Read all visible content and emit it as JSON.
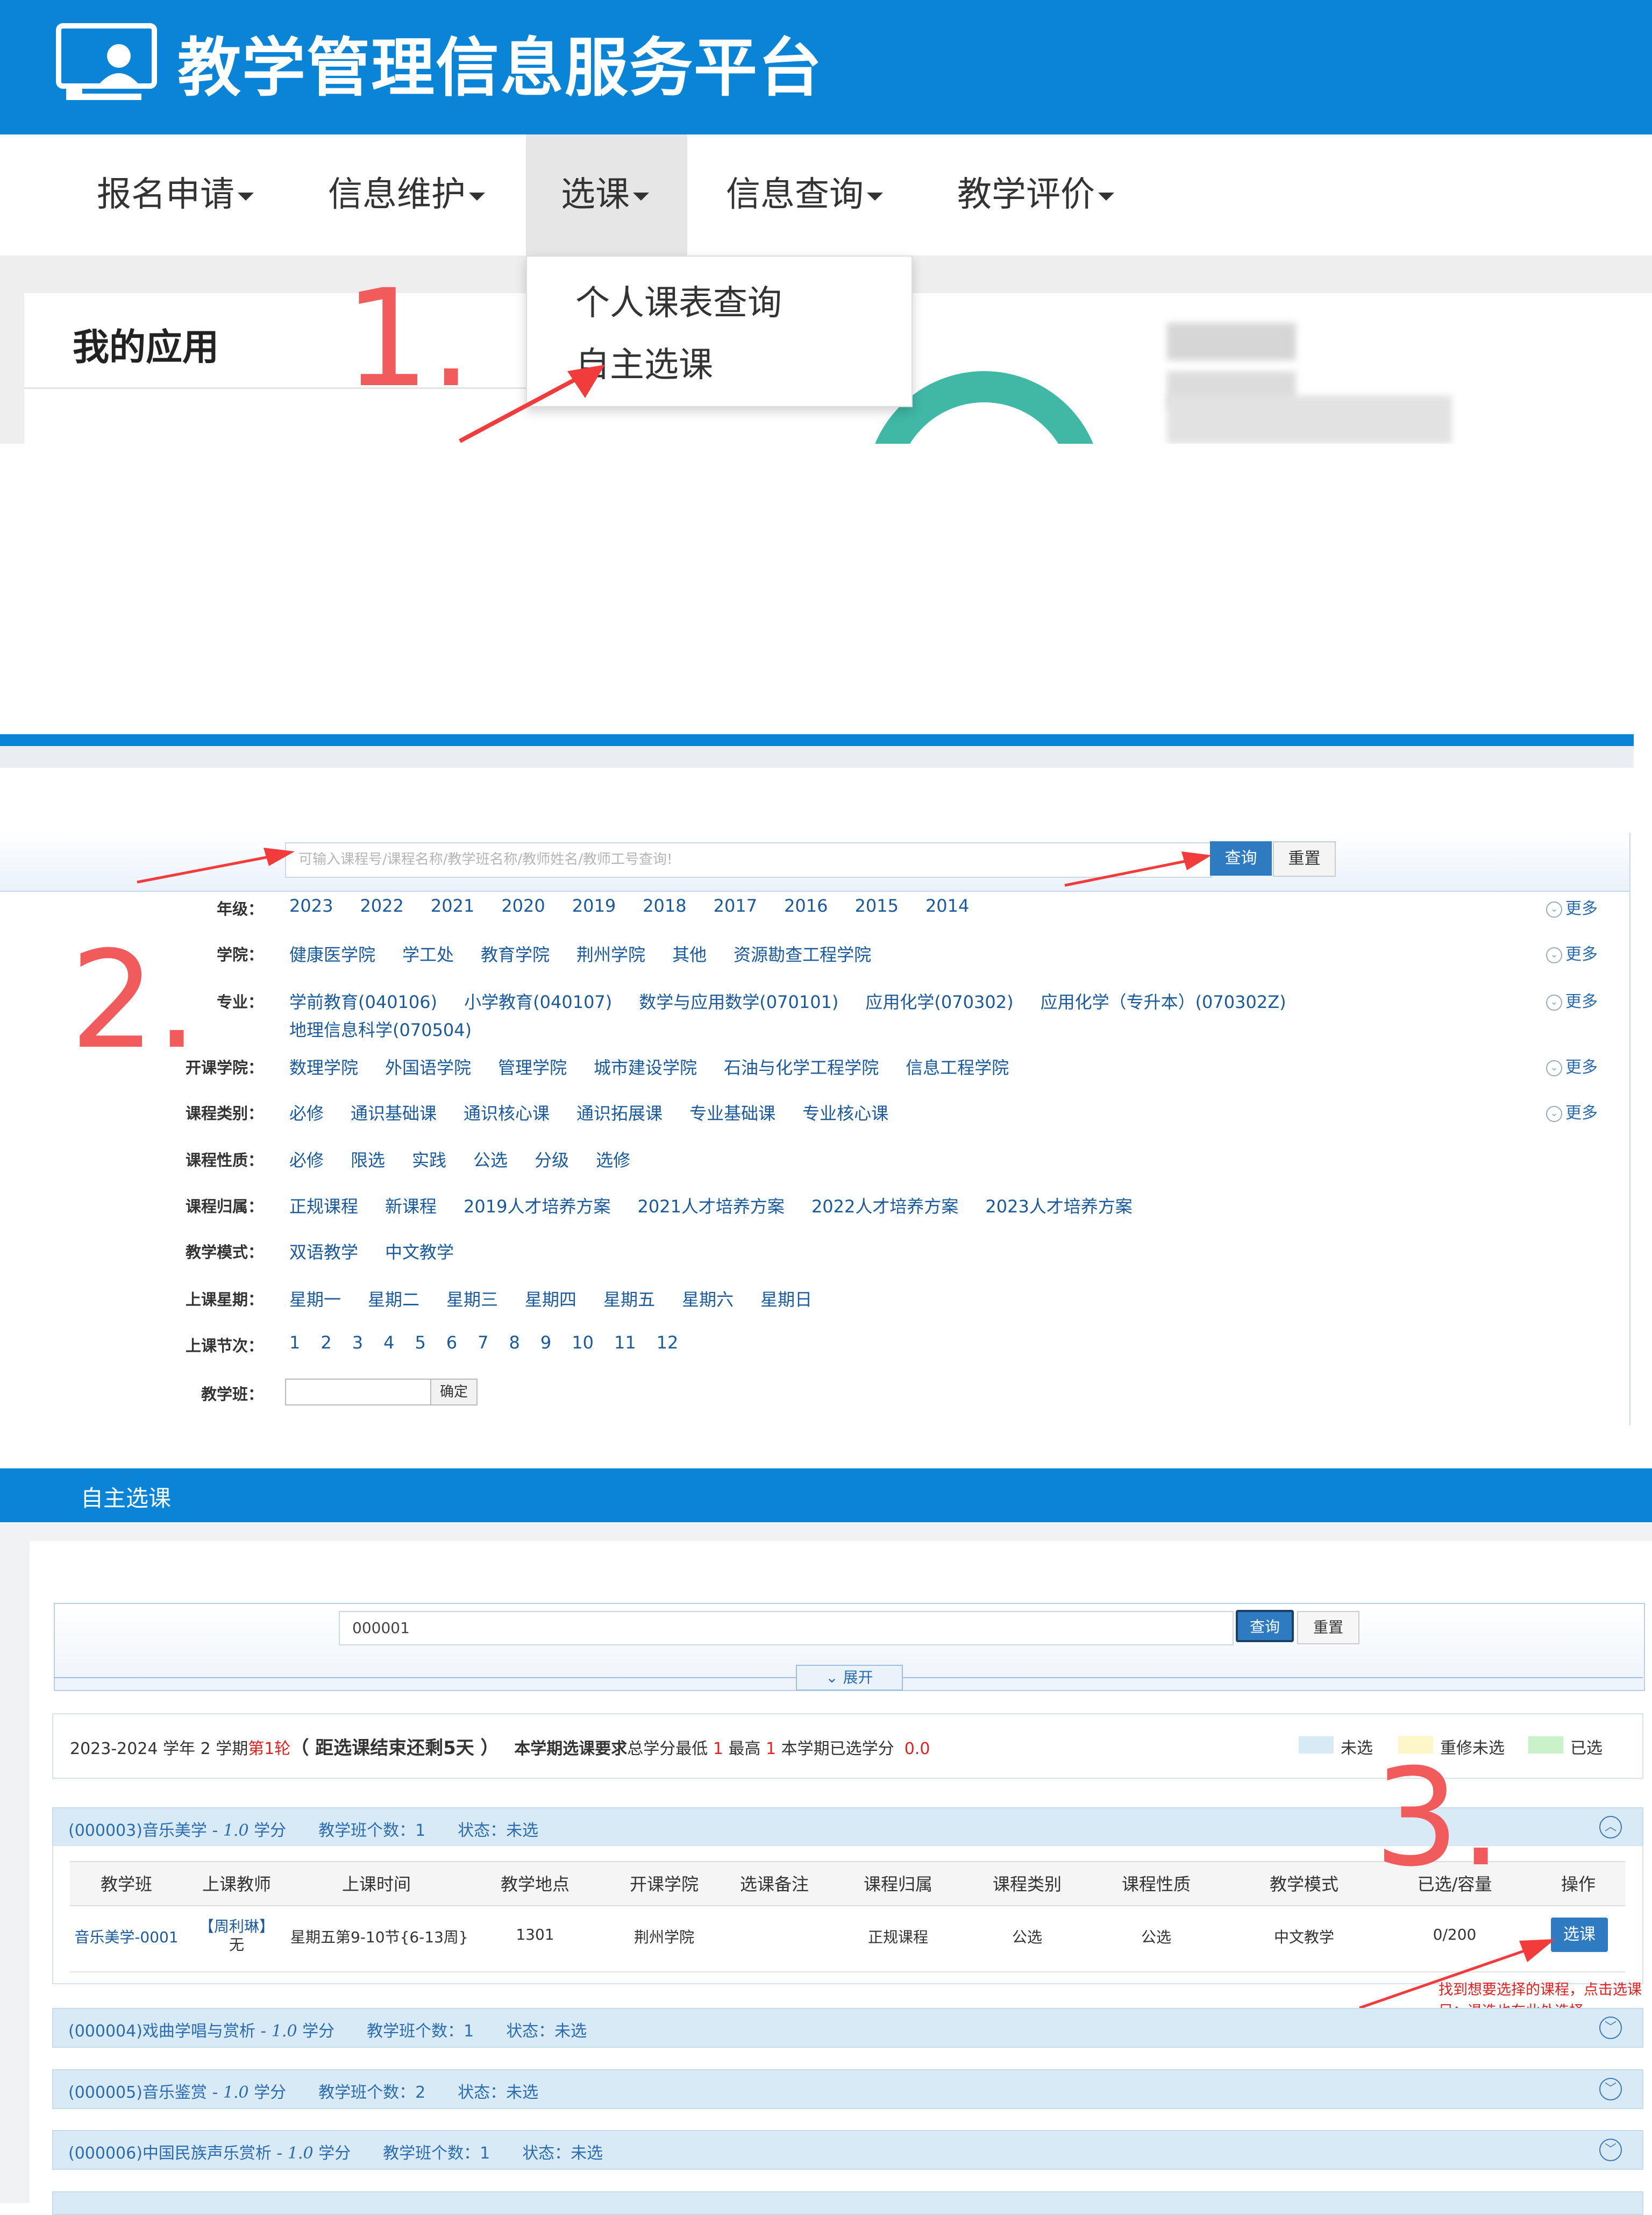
{
  "panel1": {
    "app_title": "教学管理信息服务平台",
    "nav": [
      "报名申请",
      "信息维护",
      "选课",
      "信息查询",
      "教学评价"
    ],
    "dropdown": [
      "个人课表查询",
      "自主选课"
    ],
    "card_title": "我的应用",
    "step": "1."
  },
  "panel2": {
    "search_placeholder": "可输入课程号/课程名称/教学班名称/教师姓名/教师工号查询!",
    "query_label": "查询",
    "reset_label": "重置",
    "step": "2.",
    "more_label": "更多",
    "filters": [
      {
        "label": "年级：",
        "options": [
          "2023",
          "2022",
          "2021",
          "2020",
          "2019",
          "2018",
          "2017",
          "2016",
          "2015",
          "2014"
        ]
      },
      {
        "label": "学院：",
        "options": [
          "健康医学院",
          "学工处",
          "教育学院",
          "荆州学院",
          "其他",
          "资源勘查工程学院"
        ]
      },
      {
        "label": "专业：",
        "options": [
          "学前教育(040106)",
          "小学教育(040107)",
          "数学与应用数学(070101)",
          "应用化学(070302)",
          "应用化学（专升本）(070302Z)"
        ],
        "options_line2": [
          "地理信息科学(070504)"
        ]
      },
      {
        "label": "开课学院：",
        "options": [
          "数理学院",
          "外国语学院",
          "管理学院",
          "城市建设学院",
          "石油与化学工程学院",
          "信息工程学院"
        ]
      },
      {
        "label": "课程类别：",
        "options": [
          "必修",
          "通识基础课",
          "通识核心课",
          "通识拓展课",
          "专业基础课",
          "专业核心课"
        ]
      },
      {
        "label": "课程性质：",
        "options": [
          "必修",
          "限选",
          "实践",
          "公选",
          "分级",
          "选修"
        ]
      },
      {
        "label": "课程归属：",
        "options": [
          "正规课程",
          "新课程",
          "2019人才培养方案",
          "2021人才培养方案",
          "2022人才培养方案",
          "2023人才培养方案"
        ]
      },
      {
        "label": "教学模式：",
        "options": [
          "双语教学",
          "中文教学"
        ]
      },
      {
        "label": "上课星期：",
        "options": [
          "星期一",
          "星期二",
          "星期三",
          "星期四",
          "星期五",
          "星期六",
          "星期日"
        ]
      },
      {
        "label": "上课节次：",
        "options": [
          "1",
          "2",
          "3",
          "4",
          "5",
          "6",
          "7",
          "8",
          "9",
          "10",
          "11",
          "12"
        ]
      },
      {
        "label": "教学班：",
        "options": []
      }
    ],
    "class_ok": "确定"
  },
  "panel3": {
    "bar_title": "自主选课",
    "search_value": "000001",
    "query_label": "查询",
    "reset_label": "重置",
    "expand_label": "展开",
    "info": {
      "term": "2023-2024 学年 2 学期",
      "round": "第1轮",
      "countdown": "（ 距选课结束还剩5天 ）",
      "req_label": "本学期选课要求",
      "req_text_a": "总学分最低 ",
      "min": "1",
      "req_text_b": " 最高 ",
      "max": "1",
      "selected_label": " 本学期已选学分 ",
      "selected": "0.0"
    },
    "legend": [
      {
        "label": "未选",
        "color": "#d7eaf5"
      },
      {
        "label": "重修未选",
        "color": "#fdf6c8"
      },
      {
        "label": "已选",
        "color": "#c9f2c9"
      }
    ],
    "step": "3.",
    "courses": [
      {
        "title": "(000003)音乐美学 - ",
        "credit": "1.0",
        "unit": " 学分",
        "count": "教学班个数：1",
        "status": "状态：未选"
      },
      {
        "title": "(000004)戏曲学唱与赏析 - ",
        "credit": "1.0",
        "unit": " 学分",
        "count": "教学班个数：1",
        "status": "状态：未选"
      },
      {
        "title": "(000005)音乐鉴赏 - ",
        "credit": "1.0",
        "unit": " 学分",
        "count": "教学班个数：2",
        "status": "状态：未选"
      },
      {
        "title": "(000006)中国民族声乐赏析 - ",
        "credit": "1.0",
        "unit": " 学分",
        "count": "教学班个数：1",
        "status": "状态：未选"
      }
    ],
    "table_headers": [
      "教学班",
      "上课教师",
      "上课时间",
      "教学地点",
      "开课学院",
      "选课备注",
      "课程归属",
      "课程类别",
      "课程性质",
      "教学模式",
      "已选/容量",
      "操作"
    ],
    "row": {
      "class_name": "音乐美学-0001",
      "teacher": "【周利琳】",
      "teacher_title": "无",
      "time": "星期五第9-10节{6-13周}",
      "place": "1301",
      "college": "荆州学院",
      "note": "",
      "belong": "正规课程",
      "category": "公选",
      "nature": "公选",
      "mode": "中文教学",
      "capacity": "0/200",
      "action": "选课"
    },
    "note_line1": "找到想要选择的课程，点击选课",
    "note_line2": "另：退选也在此处选择"
  }
}
